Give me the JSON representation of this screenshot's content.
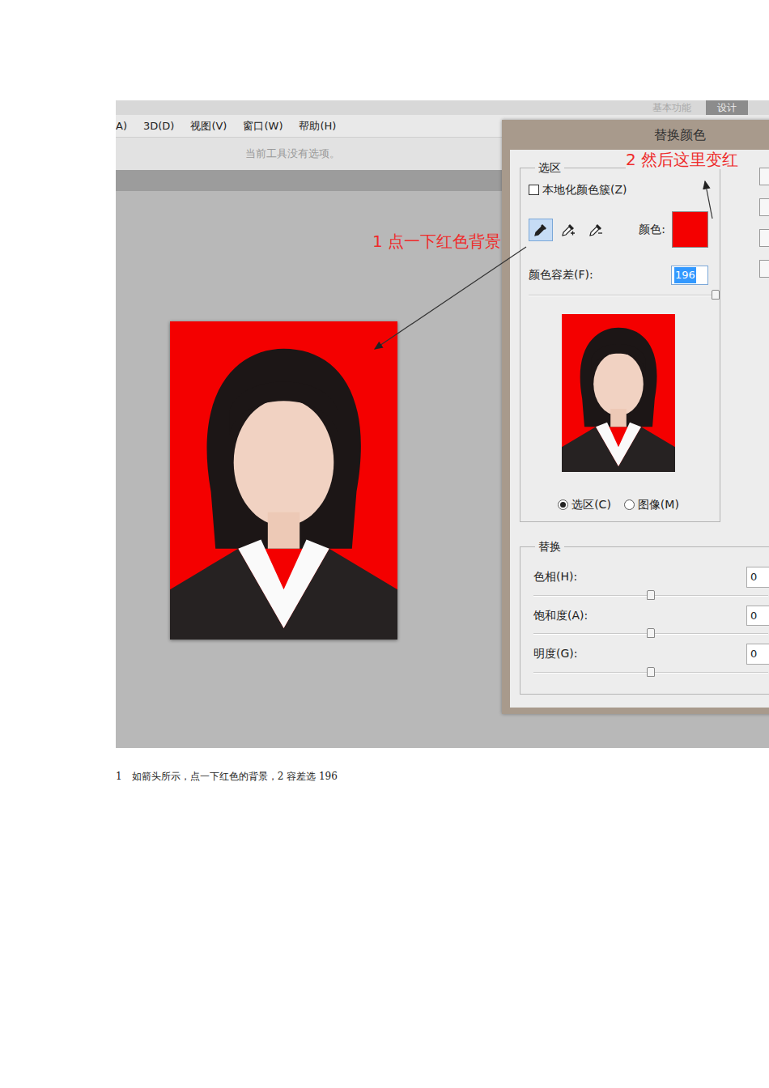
{
  "app": {
    "workspace": {
      "label": "基本功能",
      "button": "设计"
    },
    "menus": [
      "A)",
      "3D(D)",
      "视图(V)",
      "窗口(W)",
      "帮助(H)"
    ],
    "options_hint": "当前工具没有选项。"
  },
  "annotations": [
    {
      "text": "1 点一下红色背景"
    },
    {
      "text": "2 然后这里变红"
    }
  ],
  "dialog": {
    "title": "替换颜色",
    "selection_group": "选区",
    "localized": {
      "label": "本地化颜色簇(Z)",
      "checked": false
    },
    "eyedroppers": [
      {
        "selected": true
      },
      {
        "selected": false
      },
      {
        "selected": false
      }
    ],
    "color_label": "颜色:",
    "swatch_color": "#f40000",
    "tolerance": {
      "label": "颜色容差(F):",
      "value": "196",
      "level": 0.98
    },
    "view_options": [
      {
        "label": "选区(C)",
        "selected": true
      },
      {
        "label": "图像(M)",
        "selected": false
      }
    ],
    "replace_group": "替换",
    "adjustments": [
      {
        "label": "色相(H):",
        "value": "0",
        "level": 0.5
      },
      {
        "label": "饱和度(A):",
        "value": "0",
        "level": 0.5
      },
      {
        "label": "明度(G):",
        "value": "0",
        "level": 0.5
      }
    ]
  },
  "caption": "1　如箭头所示，点一下红色的背景，2 容差选 196"
}
